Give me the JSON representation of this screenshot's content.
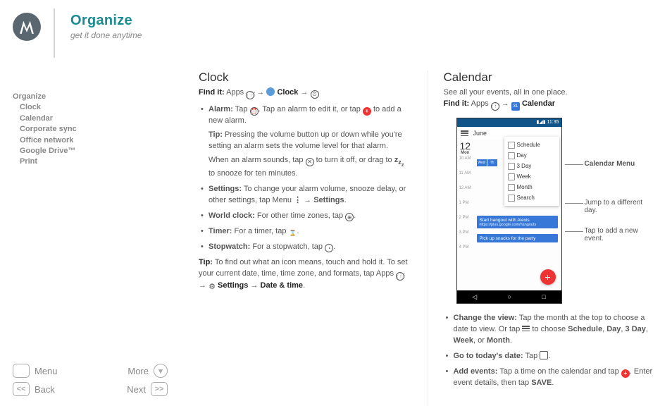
{
  "header": {
    "title": "Organize",
    "subtitle": "get it done anytime"
  },
  "toc": {
    "items": [
      "Organize",
      "Clock",
      "Calendar",
      "Corporate sync",
      "Office network",
      "Google Drive™",
      "Print"
    ]
  },
  "footer": {
    "menu": "Menu",
    "more": "More",
    "back": "Back",
    "next": "Next"
  },
  "clock": {
    "heading": "Clock",
    "findit_label": "Find it:",
    "findit_apps": "Apps",
    "findit_clock": "Clock",
    "bullets": {
      "alarm_label": "Alarm:",
      "alarm_text1": " Tap ",
      "alarm_text2": ". Tap an alarm to edit it, or tap ",
      "alarm_text3": " to add a new alarm.",
      "alarm_tip_label": "Tip:",
      "alarm_tip": " Pressing the volume button up or down while you're setting an alarm sets the volume level for that alarm.",
      "alarm_sound1": "When an alarm sounds, tap ",
      "alarm_sound2": " to turn it off, or drag to ",
      "alarm_sound3": " to snooze for ten minutes.",
      "settings_label": "Settings:",
      "settings_text1": " To change your alarm volume, snooze delay, or other settings, tap Menu ",
      "settings_arrow": " → ",
      "settings_bold": "Settings",
      "world_label": "World clock:",
      "world_text": " For other time zones, tap ",
      "timer_label": "Timer:",
      "timer_text": " For a timer, tap ",
      "stopwatch_label": "Stopwatch:",
      "stopwatch_text": " For a stopwatch, tap "
    },
    "tip_label": "Tip:",
    "tip_text1": " To find out what an icon means, touch and hold it. To set your current date, time, time zone, and formats, tap Apps ",
    "tip_arrow1": " → ",
    "tip_settings": "Settings",
    "tip_arrow2": " → ",
    "tip_datetime": "Date & time"
  },
  "calendar": {
    "heading": "Calendar",
    "intro": "See all your events, all in one place.",
    "findit_label": "Find it:",
    "findit_apps": "Apps",
    "findit_cal": "Calendar",
    "callout1": "Calendar Menu",
    "callout2": "Jump to a different day.",
    "callout3": "Tap to add a new event.",
    "bullets": {
      "change_label": "Change the view:",
      "change_text1": " Tap the month at the top to choose a date to view. Or tap ",
      "change_text2": " to choose ",
      "change_opts": [
        "Schedule",
        "Day",
        "3 Day",
        "Week",
        "Month"
      ],
      "today_label": "Go to today's date:",
      "today_text": " Tap ",
      "add_label": "Add events:",
      "add_text1": " Tap a time on the calendar and tap ",
      "add_text2": ". Enter event details, then tap ",
      "add_save": "SAVE"
    },
    "phone": {
      "status_time": "11:35",
      "month": "June",
      "day_num": "12",
      "day_name": "Mon",
      "menu": [
        "Schedule",
        "Day",
        "3 Day",
        "Week",
        "Month",
        "Search"
      ],
      "hours": [
        "10 AM",
        "11 AM",
        "12 AM",
        "1 PM",
        "2 PM",
        "3 PM",
        "4 PM"
      ],
      "ev1_title": "Start hangout with Alexis",
      "ev1_link": "https://plus.google.com/hangouts",
      "ev2_title": "Pick up snacks for the party",
      "week_labels": [
        "Wed",
        "Th"
      ]
    }
  }
}
